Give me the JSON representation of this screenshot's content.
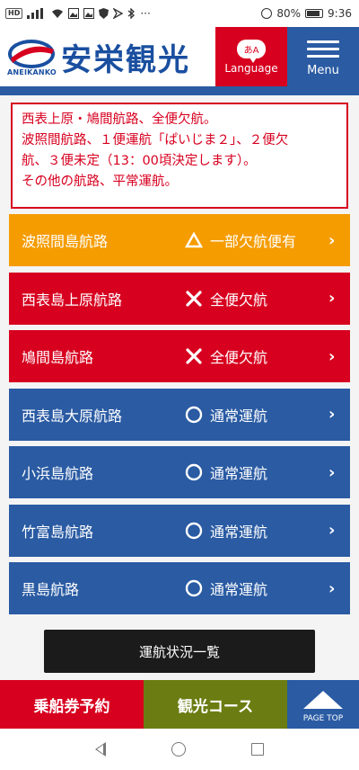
{
  "status_bar": {
    "left_badge": "HD",
    "left_more": "···",
    "battery": "80%",
    "time": "9:36"
  },
  "header": {
    "logo_small": "ANEIKANKO",
    "logo_text": "安栄観光",
    "language_bubble": "あA",
    "language_label": "Language",
    "menu_label": "Menu"
  },
  "notice": {
    "lines": [
      "西表上原・鳩間航路、全便欠航。",
      "波照間航路、１便運航「ぱいじま２」、２便欠",
      "航、３便未定（13：00頃決定します）。",
      "その他の航路、平常運航。"
    ]
  },
  "routes": [
    {
      "name": "波照間島航路",
      "status": "一部欠航便有",
      "status_icon": "triangle-icon",
      "color": "#f59c00"
    },
    {
      "name": "西表島上原航路",
      "status": "全便欠航",
      "status_icon": "cross-icon",
      "color": "#d7001f"
    },
    {
      "name": "鳩間島航路",
      "status": "全便欠航",
      "status_icon": "cross-icon",
      "color": "#d7001f"
    },
    {
      "name": "西表島大原航路",
      "status": "通常運航",
      "status_icon": "circle-icon",
      "color": "#2a5ba3"
    },
    {
      "name": "小浜島航路",
      "status": "通常運航",
      "status_icon": "circle-icon",
      "color": "#2a5ba3"
    },
    {
      "name": "竹富島航路",
      "status": "通常運航",
      "status_icon": "circle-icon",
      "color": "#2a5ba3"
    },
    {
      "name": "黒島航路",
      "status": "通常運航",
      "status_icon": "circle-icon",
      "color": "#2a5ba3"
    }
  ],
  "list_button": "運航状況一覧",
  "footer": {
    "ticket": "乗船券予約",
    "tour": "観光コース",
    "page_top": "PAGE TOP"
  }
}
